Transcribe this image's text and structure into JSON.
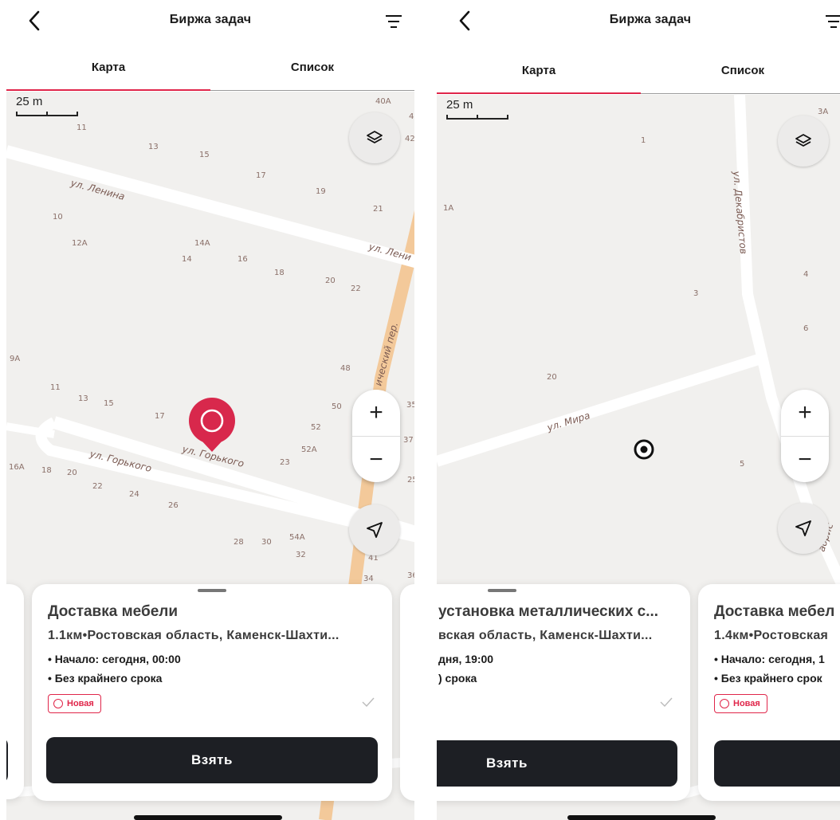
{
  "header": {
    "title": "Биржа задач"
  },
  "tabs": {
    "map": "Карта",
    "list": "Список"
  },
  "map": {
    "scale": "25 m"
  },
  "left": {
    "streets": [
      "ул. Ленина",
      "ул. Лени",
      "ул. Горького",
      "ул. Горького",
      "ический пер."
    ],
    "house_numbers": [
      "11",
      "13",
      "15",
      "17",
      "19",
      "21",
      "10",
      "12A",
      "14A",
      "14",
      "16",
      "18",
      "20",
      "22",
      "40A",
      "40",
      "42",
      "9A",
      "11",
      "13",
      "15",
      "17",
      "48",
      "50",
      "52",
      "52A",
      "23",
      "35",
      "37",
      "16A",
      "18",
      "20",
      "22",
      "24",
      "26",
      "28",
      "30",
      "54A",
      "32",
      "41",
      "34",
      "36",
      "25",
      "16",
      "20",
      "54"
    ],
    "card": {
      "title": "Доставка мебели",
      "address": "1.1км•Ростовская область, Каменск-Шахти...",
      "start": "• Начало: сегодня, 00:00",
      "deadline": "• Без крайнего срока",
      "status": "Новая",
      "button": "Взять"
    }
  },
  "right": {
    "streets": [
      "ул. Декабристов",
      "ул. Мира",
      "абрис"
    ],
    "house_numbers": [
      "3A",
      "1",
      "1A",
      "3",
      "4",
      "6",
      "20",
      "5"
    ],
    "card_center": {
      "title": "установка металлических с...",
      "address": "вская область, Каменск-Шахти...",
      "start": "дня, 19:00",
      "deadline": ") срока",
      "button": "Взять"
    },
    "card_right": {
      "title": "Доставка мебел",
      "address": "1.4км•Ростовская",
      "start": "• Начало: сегодня, 1",
      "deadline": "• Без крайнего срок",
      "status": "Новая"
    }
  },
  "colors": {
    "accent": "#e0264a",
    "dark": "#1d1f24",
    "map_bg": "#f1f0ee",
    "road_major": "#f3c99a"
  }
}
